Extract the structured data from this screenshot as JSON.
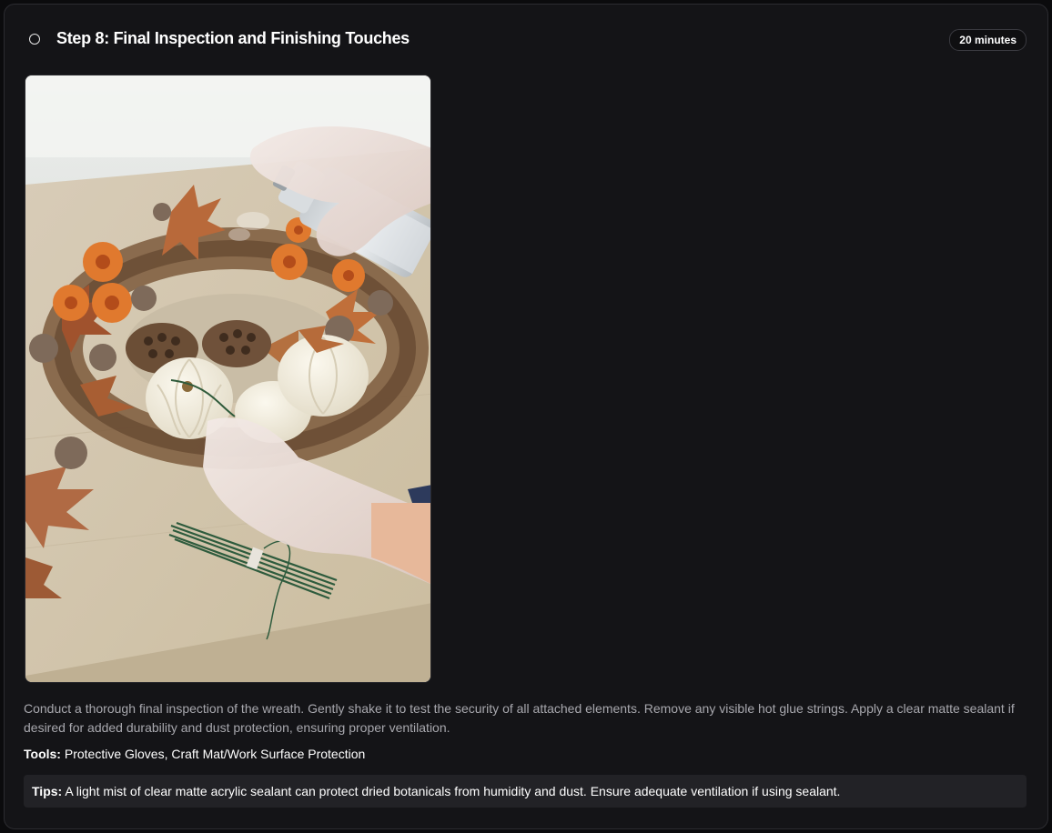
{
  "step": {
    "title": "Step 8: Final Inspection and Finishing Touches",
    "duration": "20 minutes",
    "status_icon": "empty-circle-icon",
    "completed": false,
    "image_alt": "Gloved hands spraying sealant on an autumn wreath with white pumpkins, dried flowers and leaves",
    "description": "Conduct a thorough final inspection of the wreath. Gently shake it to test the security of all attached elements. Remove any visible hot glue strings. Apply a clear matte sealant if desired for added durability and dust protection, ensuring proper ventilation.",
    "tools_label": "Tools:",
    "tools_value": "Protective Gloves, Craft Mat/Work Surface Protection",
    "tips_label": "Tips:",
    "tips_value": "A light mist of clear matte acrylic sealant can protect dried botanicals from humidity and dust. Ensure adequate ventilation if using sealant."
  },
  "colors": {
    "background": "#0b0b0d",
    "card": "#141417",
    "text_primary": "#ffffff",
    "text_secondary": "#a8a8ae",
    "tips_background": "#222226"
  }
}
